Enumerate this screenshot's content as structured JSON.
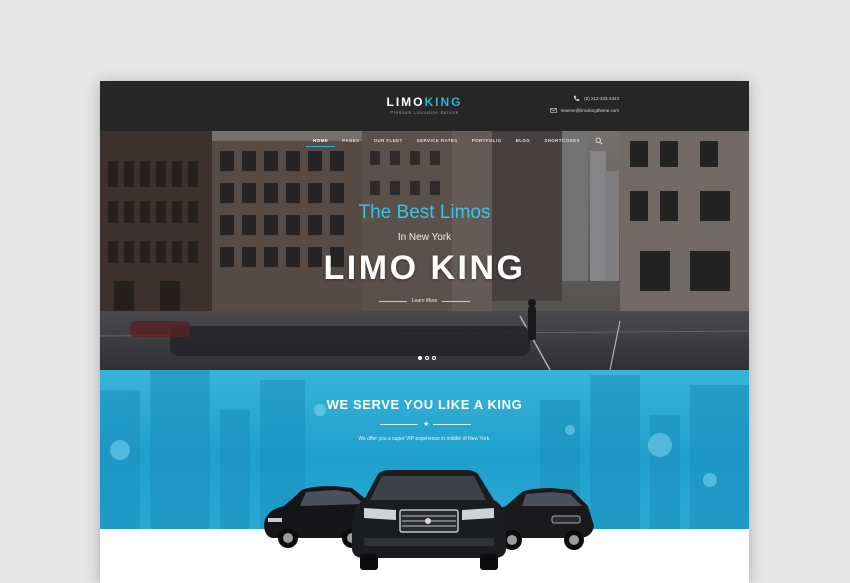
{
  "header": {
    "logo_part1": "LIMO",
    "logo_part2": "KING",
    "tagline": "Premium Limousine Service",
    "phone": "(0) 212-333-4343",
    "email": "reserve@limokingtheme.com",
    "phone_icon": "phone-icon",
    "email_icon": "envelope-icon"
  },
  "nav": {
    "items": [
      "HOME",
      "PAGES",
      "OUR FLEET",
      "SERVICE RATES",
      "PORTFOLIO",
      "BLOG",
      "SHORTCODES"
    ],
    "active_index": 0,
    "search_icon": "search-icon"
  },
  "hero": {
    "title_line1": "The Best Limos",
    "title_line2": "In New York",
    "title_line3": "LIMO KING",
    "learn_more": "Learn More"
  },
  "section": {
    "title": "WE SERVE YOU LIKE A KING",
    "divider_icon": "star-icon",
    "subtitle": "We offer you a super VIP experience in middle of New York."
  },
  "colors": {
    "accent": "#29b6d8",
    "header_bg": "#262626",
    "section_bg": "#1f9fcc"
  }
}
